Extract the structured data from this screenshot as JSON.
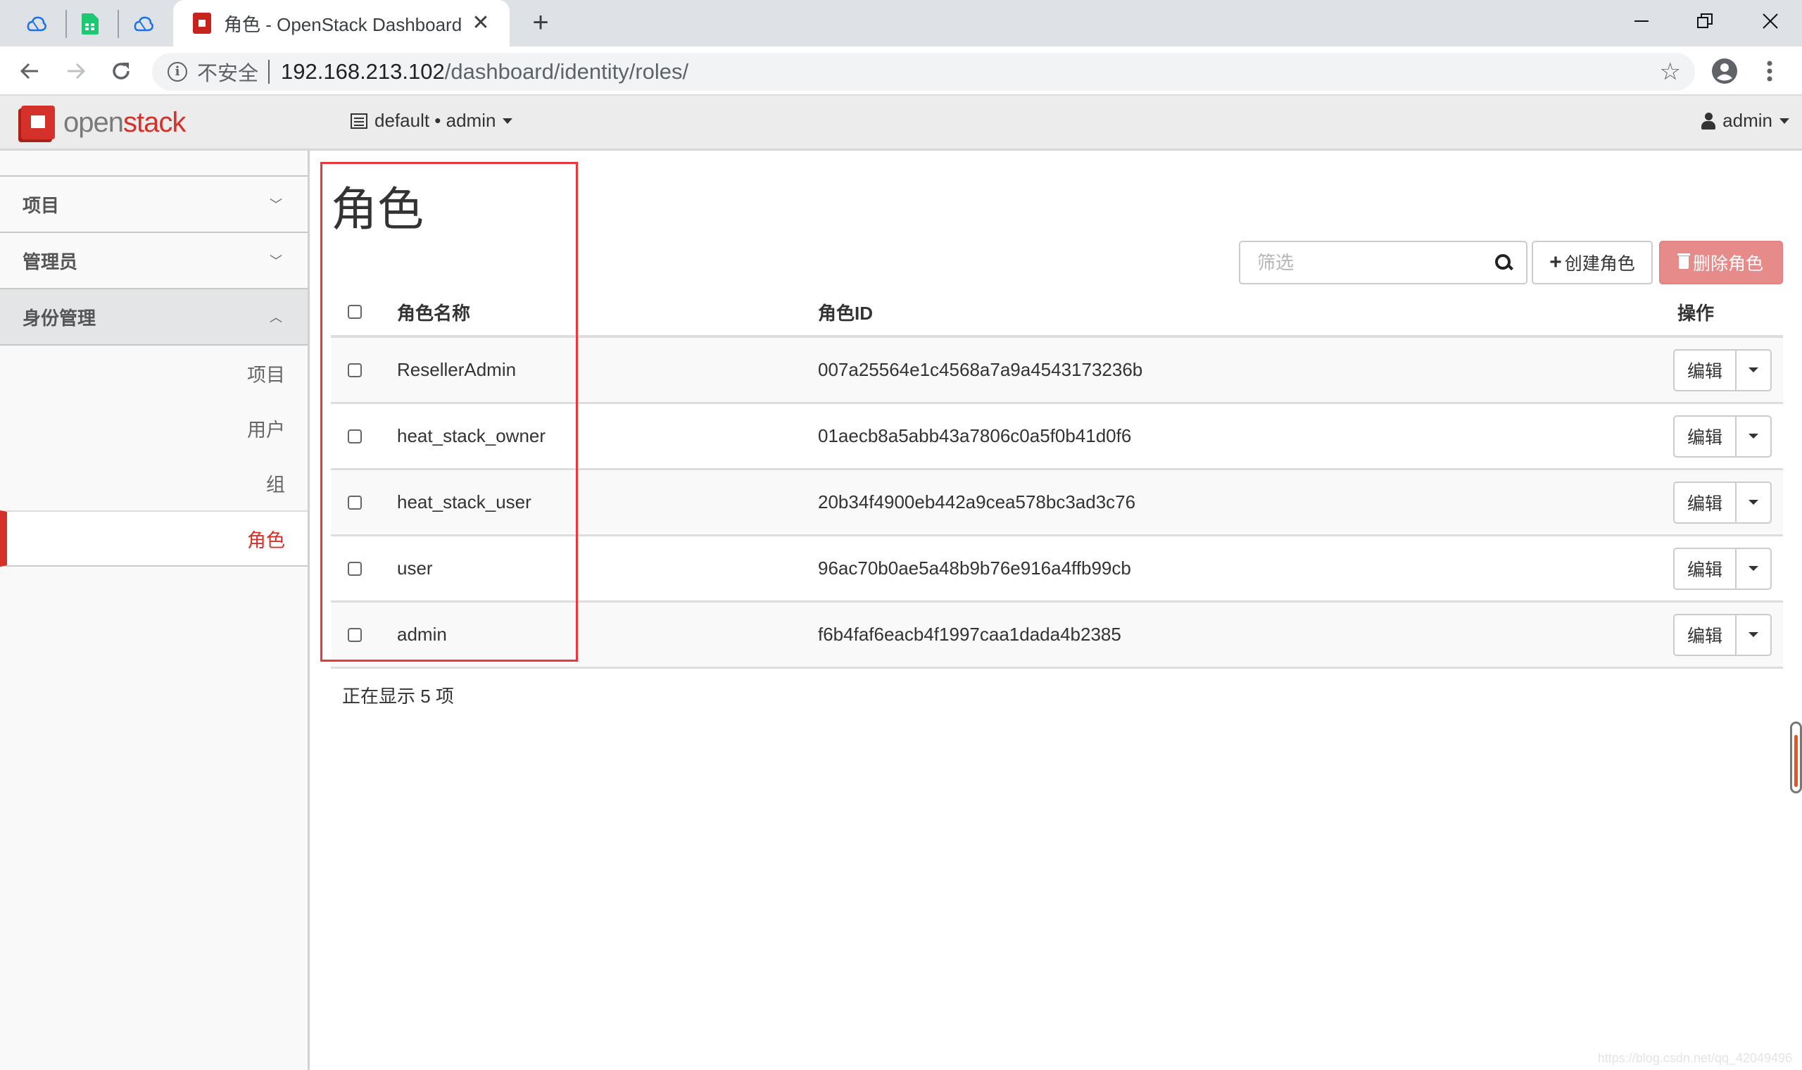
{
  "browser": {
    "pinned_tabs": [
      {
        "icon": "cloud-icon",
        "color": "#1a73e8"
      },
      {
        "icon": "spreadsheet-icon",
        "color": "#1ec872"
      },
      {
        "icon": "cloud-icon",
        "color": "#1a73e8"
      }
    ],
    "active_tab": {
      "title": "角色 - OpenStack Dashboard",
      "close": "✕"
    },
    "new_tab": "+",
    "window_controls": {
      "minimize": "—",
      "restore": "❐",
      "close": "✕"
    },
    "security_label": "不安全",
    "url_host": "192.168.213.102",
    "url_path": "/dashboard/identity/roles/",
    "bookmark_star": "☆",
    "menu_dots": "⋮"
  },
  "header": {
    "logo_open": "open",
    "logo_stack": "stack",
    "context": "default • admin",
    "user": "admin"
  },
  "sidebar": {
    "sections": [
      {
        "label": "项目",
        "chevron": "﹀",
        "expanded": false
      },
      {
        "label": "管理员",
        "chevron": "﹀",
        "expanded": false
      },
      {
        "label": "身份管理",
        "chevron": "︿",
        "expanded": true
      }
    ],
    "items": [
      {
        "label": "项目",
        "active": false
      },
      {
        "label": "用户",
        "active": false
      },
      {
        "label": "组",
        "active": false
      },
      {
        "label": "角色",
        "active": true
      }
    ]
  },
  "main": {
    "title": "角色",
    "filter_placeholder": "筛选",
    "filter_value": "",
    "create_button": "创建角色",
    "delete_button": "删除角色",
    "columns": {
      "name": "角色名称",
      "id": "角色ID",
      "actions": "操作"
    },
    "rows": [
      {
        "name": "ResellerAdmin",
        "id": "007a25564e1c4568a7a9a4543173236b",
        "action": "编辑"
      },
      {
        "name": "heat_stack_owner",
        "id": "01aecb8a5abb43a7806c0a5f0b41d0f6",
        "action": "编辑"
      },
      {
        "name": "heat_stack_user",
        "id": "20b34f4900eb442a9cea578bc3ad3c76",
        "action": "编辑"
      },
      {
        "name": "user",
        "id": "96ac70b0ae5a48b9b76e916a4ffb99cb",
        "action": "编辑"
      },
      {
        "name": "admin",
        "id": "f6b4faf6eacb4f1997caa1dada4b2385",
        "action": "编辑"
      }
    ],
    "count_text": "正在显示 5 项"
  },
  "colors": {
    "accent": "#d4312a",
    "delete_button": "#e68b89",
    "highlight_box": "#e8383d"
  },
  "watermark": "https://blog.csdn.net/qq_42049496"
}
